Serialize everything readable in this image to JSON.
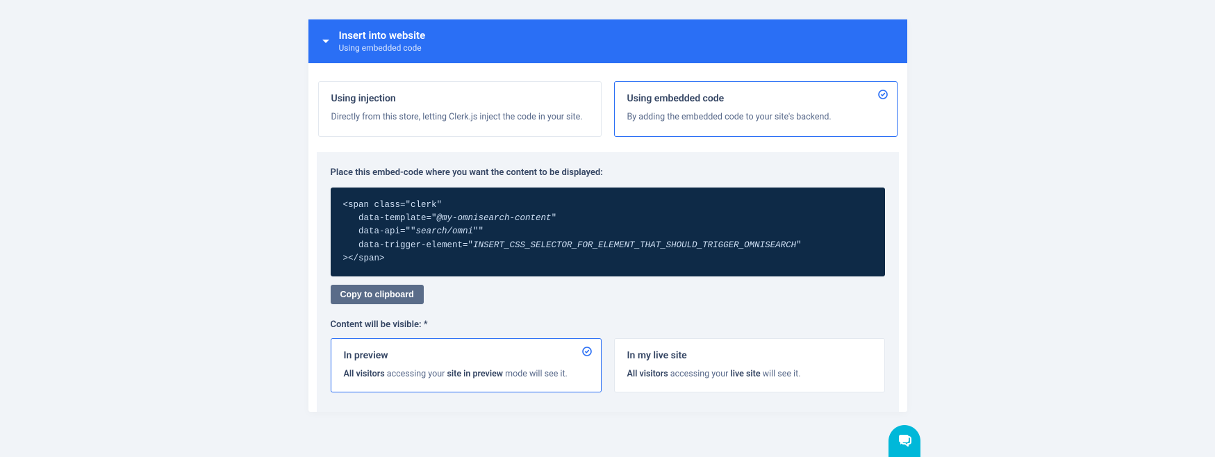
{
  "header": {
    "title": "Insert into website",
    "subtitle": "Using embedded code"
  },
  "methods": {
    "injection": {
      "title": "Using injection",
      "desc": "Directly from this store, letting Clerk.js inject the code in your site."
    },
    "embedded": {
      "title": "Using embedded code",
      "desc": "By adding the embedded code to your site's backend."
    }
  },
  "embed": {
    "label": "Place this embed-code where you want the content to be displayed:",
    "code_line1": "<span class=\"clerk\"",
    "code_line2a": "   data-template=\"",
    "code_line2b": "@my-omnisearch-content",
    "code_line2c": "\"",
    "code_line3a": "   data-api=\"\"",
    "code_line3b": "search/omni",
    "code_line3c": "\"\"",
    "code_line4a": "   data-trigger-element=\"",
    "code_line4b": "INSERT_CSS_SELECTOR_FOR_ELEMENT_THAT_SHOULD_TRIGGER_OMNISEARCH",
    "code_line4c": "\"",
    "code_line5": "></span>",
    "copy_label": "Copy to clipboard"
  },
  "visibility": {
    "label": "Content will be visible: *",
    "preview": {
      "title": "In preview",
      "desc_bold1": "All visitors",
      "desc_mid": " accessing your ",
      "desc_bold2": "site in preview",
      "desc_tail": " mode will see it."
    },
    "live": {
      "title": "In my live site",
      "desc_bold1": "All visitors",
      "desc_mid": " accessing your ",
      "desc_bold2": "live site",
      "desc_tail": " will see it."
    }
  }
}
